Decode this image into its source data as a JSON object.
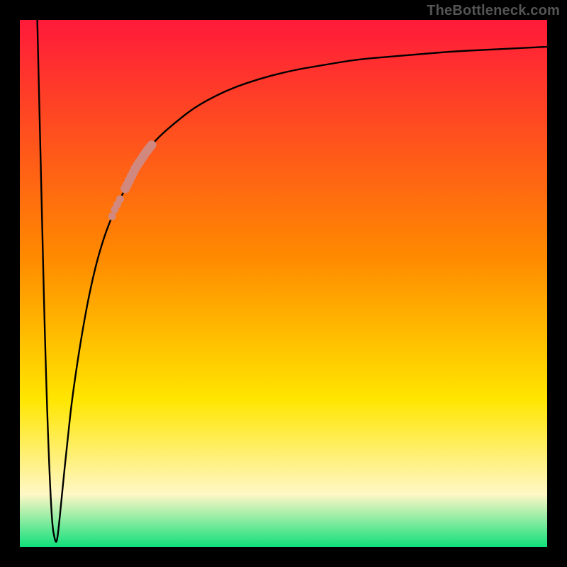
{
  "watermark": "TheBottleneck.com",
  "colors": {
    "frame": "#000000",
    "curve": "#000000",
    "highlight_marker": "#d1897f",
    "gradient_top": "#ff1a3a",
    "gradient_mid_upper": "#ff8a00",
    "gradient_mid": "#ffe600",
    "gradient_cream": "#fff7c6",
    "gradient_green": "#0fe07a"
  },
  "chart_data": {
    "type": "line",
    "title": "",
    "xlabel": "",
    "ylabel": "",
    "xlim": [
      0,
      100
    ],
    "ylim": [
      0,
      100
    ],
    "grid": false,
    "legend": false,
    "series": [
      {
        "name": "bottleneck-curve",
        "x": [
          3.3,
          4.0,
          5.0,
          6.0,
          6.7,
          7.0,
          7.3,
          8.0,
          9.0,
          10.0,
          12.0,
          14.0,
          16.0,
          18.0,
          20.0,
          22.0,
          24.0,
          26.0,
          30.0,
          34.0,
          40.0,
          46.0,
          52.0,
          58.0,
          64.0,
          70.0,
          76.0,
          82.0,
          88.0,
          94.0,
          100.0
        ],
        "y": [
          100.0,
          70.0,
          30.0,
          5.0,
          1.0,
          1.0,
          3.0,
          10.0,
          20.0,
          29.0,
          42.0,
          52.0,
          59.0,
          64.0,
          68.0,
          72.0,
          75.0,
          77.5,
          81.0,
          84.0,
          87.0,
          89.0,
          90.5,
          91.5,
          92.5,
          93.0,
          93.5,
          94.0,
          94.3,
          94.6,
          94.9
        ]
      }
    ],
    "annotations": [
      {
        "name": "highlight-range-upper",
        "x_range": [
          20.0,
          25.0
        ],
        "y_range": [
          68.0,
          76.0
        ]
      },
      {
        "name": "highlight-range-lower",
        "x_range": [
          17.5,
          19.0
        ],
        "y_range": [
          62.0,
          66.0
        ]
      }
    ]
  }
}
